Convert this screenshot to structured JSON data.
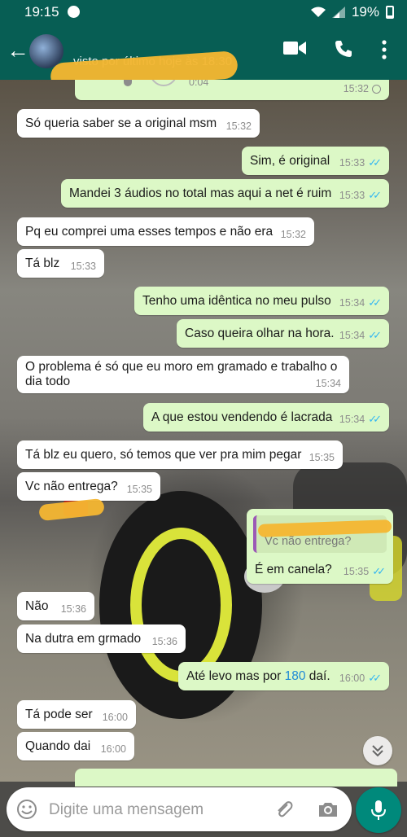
{
  "status_bar": {
    "time": "19:15",
    "battery": "19%"
  },
  "header": {
    "contact_name": "",
    "last_seen": "visto por último hoje às 18:30",
    "icons": [
      "back-arrow-icon",
      "video-call-icon",
      "phone-icon",
      "more-vert-icon"
    ]
  },
  "audio_message": {
    "duration": "0:04",
    "time": "15:32"
  },
  "messages": [
    {
      "dir": "in",
      "text": "Só queria saber se a original msm",
      "time": "15:32"
    },
    {
      "dir": "out",
      "text": "Sim, é original",
      "time": "15:33"
    },
    {
      "dir": "out",
      "text": "Mandei 3 áudios no total mas aqui a net é ruim",
      "time": "15:33"
    },
    {
      "dir": "in",
      "text": "Pq eu comprei uma esses tempos e não era",
      "time": "15:32"
    },
    {
      "dir": "in",
      "text": "Tá blz",
      "time": "15:33"
    },
    {
      "dir": "out",
      "text": "Tenho uma idêntica no meu pulso",
      "time": "15:34"
    },
    {
      "dir": "out",
      "text": "Caso queira olhar na hora.",
      "time": "15:34"
    },
    {
      "dir": "in",
      "text_line1": "O problema é só que eu moro em gramado e trabalho o",
      "text_line2": "dia todo",
      "time": "15:34"
    },
    {
      "dir": "out",
      "text": "A que estou vendendo é lacrada",
      "time": "15:34"
    },
    {
      "dir": "in",
      "text": "Tá blz eu quero, só temos que ver pra mim pegar",
      "time": "15:35"
    },
    {
      "dir": "in",
      "text": "Vc não entrega?",
      "time": "15:35"
    },
    {
      "dir": "out",
      "quoted_text": "Vc não entrega?",
      "text": "É em canela?",
      "time": "15:35"
    },
    {
      "dir": "in",
      "text": "Não",
      "time": "15:36"
    },
    {
      "dir": "in",
      "text": "Na dutra em grmado",
      "time": "15:36"
    },
    {
      "dir": "out",
      "text_before": "Até levo mas por ",
      "text_link": "180",
      "text_after": " daí.",
      "time": "16:00"
    },
    {
      "dir": "in",
      "text": "Tá pode ser",
      "time": "16:00"
    },
    {
      "dir": "in",
      "text": "Quando dai",
      "time": "16:00"
    }
  ],
  "composer": {
    "placeholder": "Digite uma mensagem",
    "icons": [
      "emoji-icon",
      "attach-icon",
      "camera-icon",
      "mic-icon"
    ]
  },
  "colors": {
    "header": "#075e54",
    "bubble_out": "#dcf8c6",
    "bubble_in": "#ffffff",
    "read_ticks": "#34b7f1",
    "mic_button": "#00897b"
  }
}
